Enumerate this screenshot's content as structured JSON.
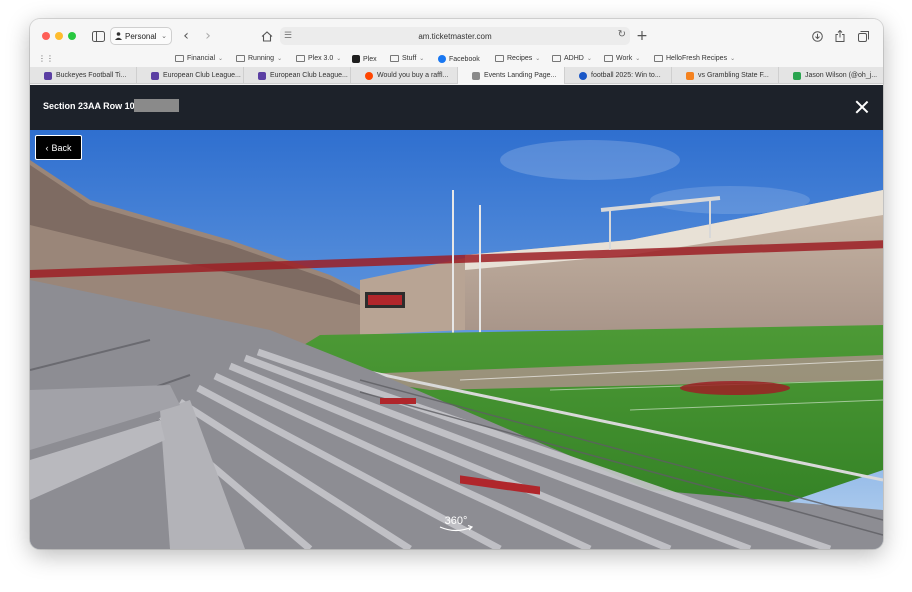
{
  "browser": {
    "profile_label": "Personal",
    "url": "am.ticketmaster.com"
  },
  "bookmarks": [
    {
      "label": "Financial",
      "has_menu": true
    },
    {
      "label": "Running",
      "has_menu": true
    },
    {
      "label": "Plex 3.0",
      "has_menu": true
    },
    {
      "label": "Plex",
      "has_menu": false
    },
    {
      "label": "Stuff",
      "has_menu": true
    },
    {
      "label": "Facebook",
      "has_menu": false
    },
    {
      "label": "Recipes",
      "has_menu": true
    },
    {
      "label": "ADHD",
      "has_menu": true
    },
    {
      "label": "Work",
      "has_menu": true
    },
    {
      "label": "HelloFresh Recipes",
      "has_menu": true
    }
  ],
  "tabs": [
    {
      "label": "Buckeyes Football Ti...",
      "favicon_color": "#5b3fa3"
    },
    {
      "label": "European Club League...",
      "favicon_color": "#5b3fa3"
    },
    {
      "label": "European Club League...",
      "favicon_color": "#5b3fa3"
    },
    {
      "label": "Would you buy a raffl...",
      "favicon_color": "#ff4500"
    },
    {
      "label": "Events Landing Page...",
      "favicon_color": "#8a8a8a"
    },
    {
      "label": "football 2025: Win to...",
      "favicon_color": "#1a57c7"
    },
    {
      "label": "vs Grambling State F...",
      "favicon_color": "#f5821f"
    },
    {
      "label": "Jason Wilson (@oh_j...",
      "favicon_color": "#2aa44f"
    }
  ],
  "modal": {
    "section_label": "Section 23AA Row 10",
    "back_label": "Back",
    "rotate_label": "360°"
  },
  "colors": {
    "header_bg": "#1d222a",
    "sky": "#3f7fd6",
    "turf": "#3f8f2c"
  }
}
